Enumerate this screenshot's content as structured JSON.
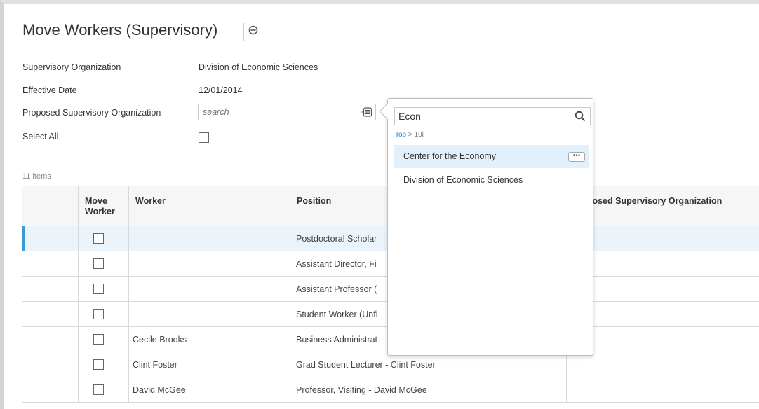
{
  "page": {
    "title": "Move Workers (Supervisory)",
    "related_icon": "related-actions-icon"
  },
  "form": {
    "supervisory_org_label": "Supervisory Organization",
    "supervisory_org_value": "Division of Economic Sciences",
    "effective_date_label": "Effective Date",
    "effective_date_value": "12/01/2014",
    "proposed_org_label": "Proposed Supervisory Organization",
    "proposed_org_placeholder": "search",
    "select_all_label": "Select All",
    "select_all_checked": false
  },
  "grid": {
    "count_label": "11 items",
    "headers": {
      "move_worker": "Move Worker",
      "worker": "Worker",
      "position": "Position",
      "proposed_org": "Proposed Supervisory Organization"
    },
    "rows": [
      {
        "worker": "",
        "position": "Postdoctoral Scholar",
        "proposed_org": "",
        "checked": false,
        "selected": true
      },
      {
        "worker": "",
        "position": "Assistant Director, Fi",
        "proposed_org": "",
        "checked": false,
        "selected": false
      },
      {
        "worker": "",
        "position": "Assistant Professor (",
        "proposed_org": "",
        "checked": false,
        "selected": false
      },
      {
        "worker": "",
        "position": "Student Worker (Unfi",
        "proposed_org": "",
        "checked": false,
        "selected": false
      },
      {
        "worker": "Cecile Brooks",
        "position": "Business Administrat",
        "proposed_org": "",
        "checked": false,
        "selected": false
      },
      {
        "worker": "Clint Foster",
        "position": "Grad Student Lecturer - Clint Foster",
        "proposed_org": "",
        "checked": false,
        "selected": false
      },
      {
        "worker": "David McGee",
        "position": "Professor, Visiting - David McGee",
        "proposed_org": "",
        "checked": false,
        "selected": false
      }
    ]
  },
  "popup": {
    "search_value": "Econ",
    "breadcrumb_top": "Top",
    "breadcrumb_sep": ">",
    "breadcrumb_current": "10i",
    "options": [
      {
        "label": "Center for the Economy",
        "highlighted": true,
        "has_more": true
      },
      {
        "label": "Division of Economic Sciences",
        "highlighted": false,
        "has_more": false
      }
    ],
    "more_label": "•••"
  },
  "colors": {
    "accent": "#3c9ad6",
    "link": "#2a7ab8",
    "row_selected": "#eaf4fa",
    "option_highlight": "#e1f0fa"
  }
}
